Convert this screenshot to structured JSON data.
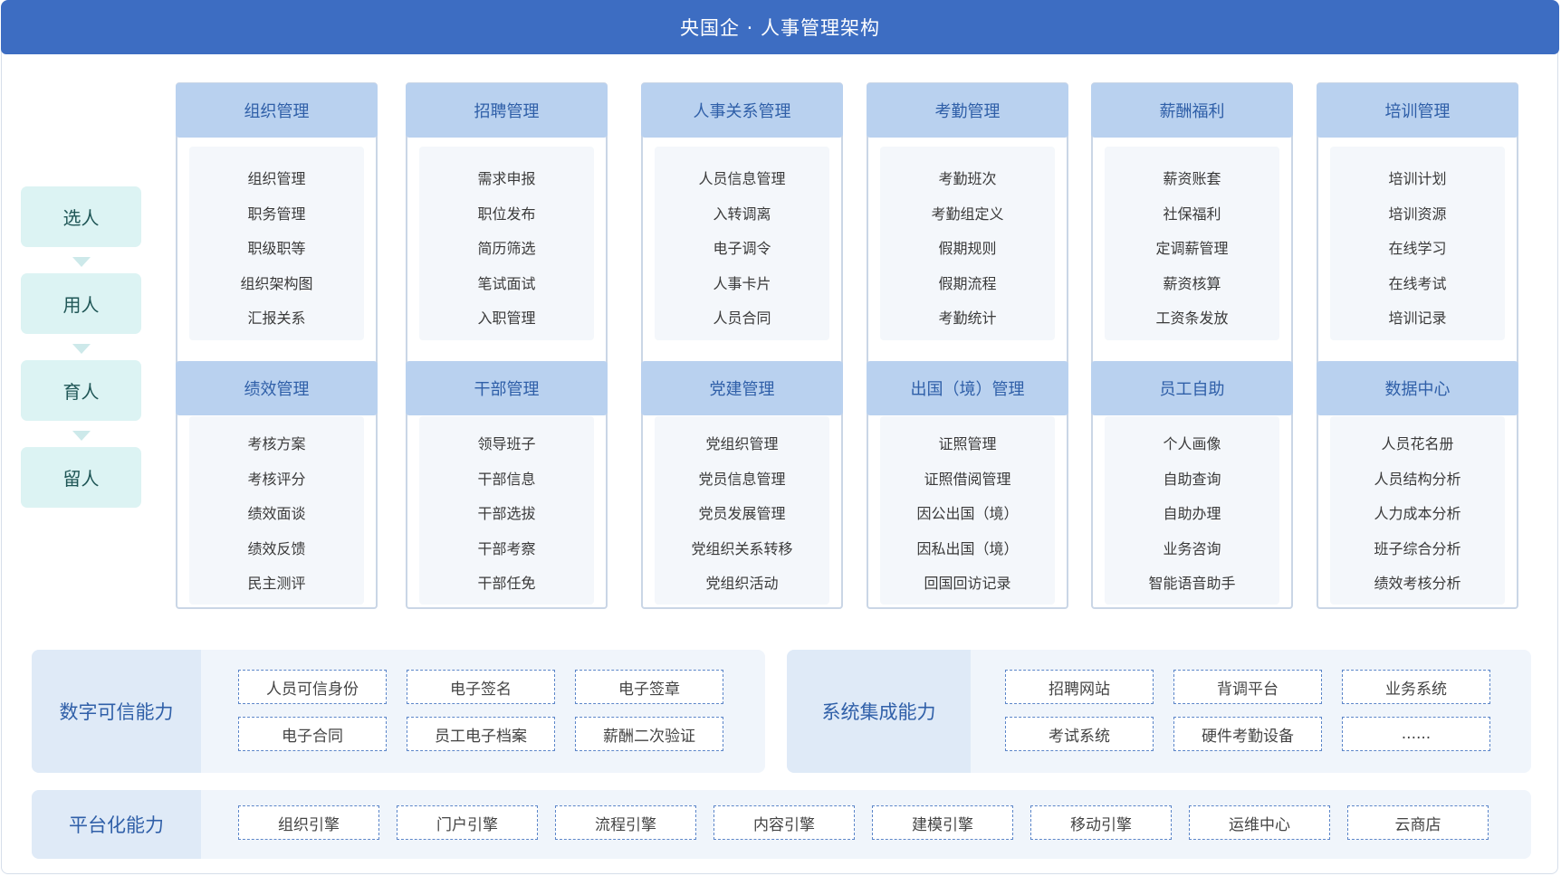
{
  "title": "央国企 · 人事管理架构",
  "stages": [
    "选人",
    "用人",
    "育人",
    "留人"
  ],
  "modules_top": [
    {
      "title": "组织管理",
      "items": [
        "组织管理",
        "职务管理",
        "职级职等",
        "组织架构图",
        "汇报关系"
      ]
    },
    {
      "title": "招聘管理",
      "items": [
        "需求申报",
        "职位发布",
        "简历筛选",
        "笔试面试",
        "入职管理"
      ]
    },
    {
      "title": "人事关系管理",
      "items": [
        "人员信息管理",
        "入转调离",
        "电子调令",
        "人事卡片",
        "人员合同"
      ]
    },
    {
      "title": "考勤管理",
      "items": [
        "考勤班次",
        "考勤组定义",
        "假期规则",
        "假期流程",
        "考勤统计"
      ]
    },
    {
      "title": "薪酬福利",
      "items": [
        "薪资账套",
        "社保福利",
        "定调薪管理",
        "薪资核算",
        "工资条发放"
      ]
    },
    {
      "title": "培训管理",
      "items": [
        "培训计划",
        "培训资源",
        "在线学习",
        "在线考试",
        "培训记录"
      ]
    }
  ],
  "modules_bottom": [
    {
      "title": "绩效管理",
      "items": [
        "考核方案",
        "考核评分",
        "绩效面谈",
        "绩效反馈",
        "民主测评"
      ]
    },
    {
      "title": "干部管理",
      "items": [
        "领导班子",
        "干部信息",
        "干部选拔",
        "干部考察",
        "干部任免"
      ]
    },
    {
      "title": "党建管理",
      "items": [
        "党组织管理",
        "党员信息管理",
        "党员发展管理",
        "党组织关系转移",
        "党组织活动"
      ]
    },
    {
      "title": "出国（境）管理",
      "items": [
        "证照管理",
        "证照借阅管理",
        "因公出国（境）",
        "因私出国（境）",
        "回国回访记录"
      ]
    },
    {
      "title": "员工自助",
      "items": [
        "个人画像",
        "自助查询",
        "自助办理",
        "业务咨询",
        "智能语音助手"
      ]
    },
    {
      "title": "数据中心",
      "items": [
        "人员花名册",
        "人员结构分析",
        "人力成本分析",
        "班子综合分析",
        "绩效考核分析"
      ]
    }
  ],
  "digital_trust": {
    "label": "数字可信能力",
    "items": [
      "人员可信身份",
      "电子签名",
      "电子签章",
      "电子合同",
      "员工电子档案",
      "薪酬二次验证"
    ]
  },
  "system_integration": {
    "label": "系统集成能力",
    "items": [
      "招聘网站",
      "背调平台",
      "业务系统",
      "考试系统",
      "硬件考勤设备",
      "......"
    ]
  },
  "platform": {
    "label": "平台化能力",
    "items": [
      "组织引擎",
      "门户引擎",
      "流程引擎",
      "内容引擎",
      "建模引擎",
      "移动引擎",
      "运维中心",
      "云商店"
    ]
  }
}
